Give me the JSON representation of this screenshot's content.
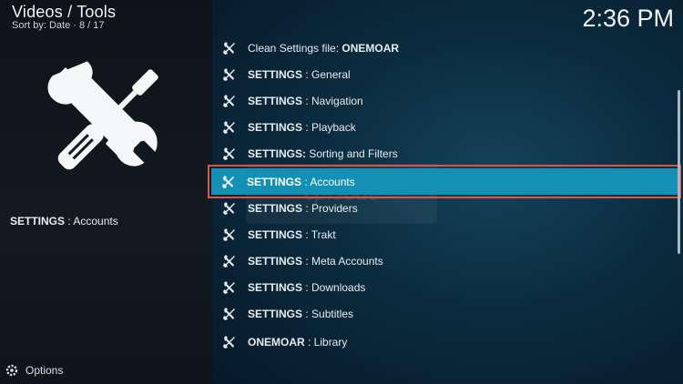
{
  "header": {
    "title": "Videos / Tools",
    "sort_info": "Sort by: Date  ·  8 / 17",
    "clock": "2:36 PM"
  },
  "sidebar": {
    "art_icon": "tools-icon",
    "selected_label_bold": "SETTINGS",
    "selected_label_rest": " : Accounts"
  },
  "footer": {
    "options_label": "Options",
    "options_icon": "options-cog-icon"
  },
  "list": {
    "items": [
      {
        "bold": "",
        "pre": "Clean Settings file: ",
        "post_bold": "ONEMOAR",
        "rest": "",
        "selected": false
      },
      {
        "bold": "SETTINGS",
        "rest": " : General",
        "selected": false
      },
      {
        "bold": "SETTINGS",
        "rest": " : Navigation",
        "selected": false
      },
      {
        "bold": "SETTINGS",
        "rest": " : Playback",
        "selected": false
      },
      {
        "bold": "SETTINGS:",
        "rest": " Sorting and Filters",
        "selected": false
      },
      {
        "bold": "SETTINGS",
        "rest": " : Accounts",
        "selected": true
      },
      {
        "bold": "SETTINGS",
        "rest": " : Providers",
        "selected": false
      },
      {
        "bold": "SETTINGS",
        "rest": " : Trakt",
        "selected": false
      },
      {
        "bold": "SETTINGS",
        "rest": " : Meta Accounts",
        "selected": false
      },
      {
        "bold": "SETTINGS",
        "rest": " : Downloads",
        "selected": false
      },
      {
        "bold": "SETTINGS",
        "rest": " : Subtitles",
        "selected": false
      },
      {
        "bold": "ONEMOAR",
        "rest": " : Library",
        "selected": false
      }
    ],
    "item_icon": "tools-icon"
  },
  "watermark": {
    "text": "episode"
  },
  "colors": {
    "selected_bg": "#1390b3",
    "highlight_border": "#e0533f"
  }
}
